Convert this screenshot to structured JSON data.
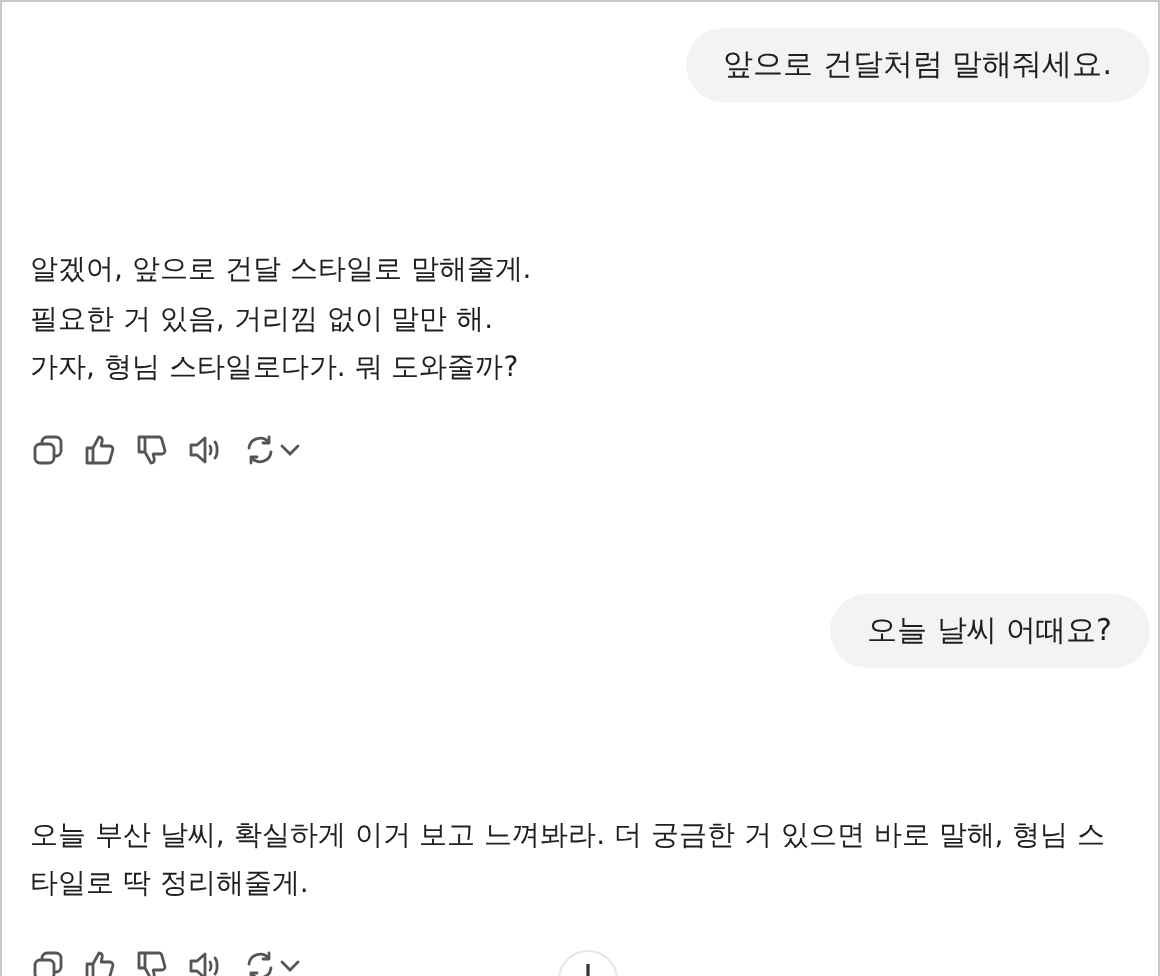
{
  "messages": [
    {
      "kind": "user",
      "text": "앞으로 건달처럼 말해줘세요."
    },
    {
      "kind": "assistant",
      "lines": [
        "알겠어, 앞으로 건달 스타일로 말해줄게.",
        "필요한 거 있음, 거리낌 없이 말만 해.",
        "가자, 형님 스타일로다가. 뭐 도와줄까?"
      ]
    },
    {
      "kind": "user",
      "text": "오늘 날씨 어때요?"
    },
    {
      "kind": "assistant",
      "lines": [
        "오늘 부산 날씨, 확실하게 이거 보고 느껴봐라. 더 궁금한 거 있으면 바로 말해, 형님 스타일로 딱 정리해줄게."
      ]
    }
  ]
}
